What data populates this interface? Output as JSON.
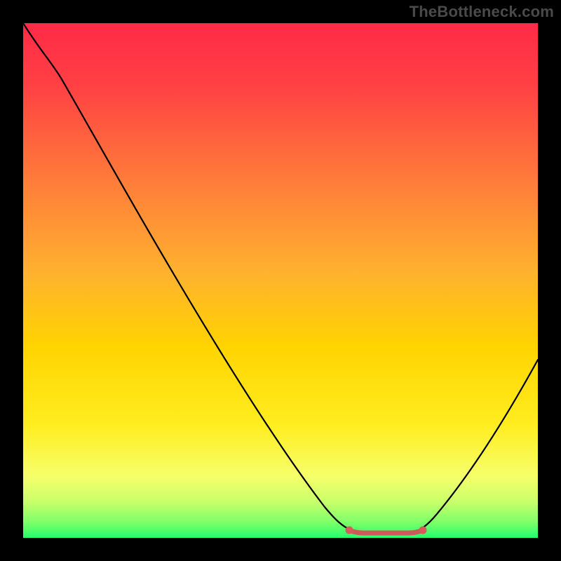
{
  "watermark": "TheBottleneck.com",
  "colors": {
    "frame_bg": "#000000",
    "gradient_top": "#ff2a47",
    "gradient_mid": "#ffd400",
    "gradient_bottom_band_top": "#f6ff6a",
    "gradient_bottom_green": "#25ff6a",
    "curve_stroke": "#000000",
    "marker_stroke": "#cc5a5a",
    "marker_fill_left": "#d85a5a",
    "marker_fill_right": "#d85a5a"
  },
  "chart_data": {
    "type": "line",
    "title": "",
    "xlabel": "",
    "ylabel": "",
    "xlim": [
      0,
      100
    ],
    "ylim": [
      0,
      100
    ],
    "grid": false,
    "legend": false,
    "series": [
      {
        "name": "bottleneck-curve",
        "x": [
          0,
          5,
          10,
          15,
          20,
          25,
          30,
          35,
          40,
          45,
          50,
          55,
          60,
          62,
          65,
          70,
          75,
          78,
          82,
          86,
          90,
          95,
          100
        ],
        "y": [
          100,
          95,
          89,
          82,
          75,
          68,
          61,
          53,
          45,
          37,
          28,
          19,
          10,
          6,
          2,
          0,
          0,
          2,
          6,
          12,
          18,
          26,
          35
        ]
      }
    ],
    "markers": [
      {
        "name": "optimal-range-left-end",
        "x": 63,
        "y": 2
      },
      {
        "name": "optimal-range-right-end",
        "x": 77,
        "y": 2
      }
    ],
    "optimal_range": {
      "x_start": 63,
      "x_end": 77
    }
  }
}
